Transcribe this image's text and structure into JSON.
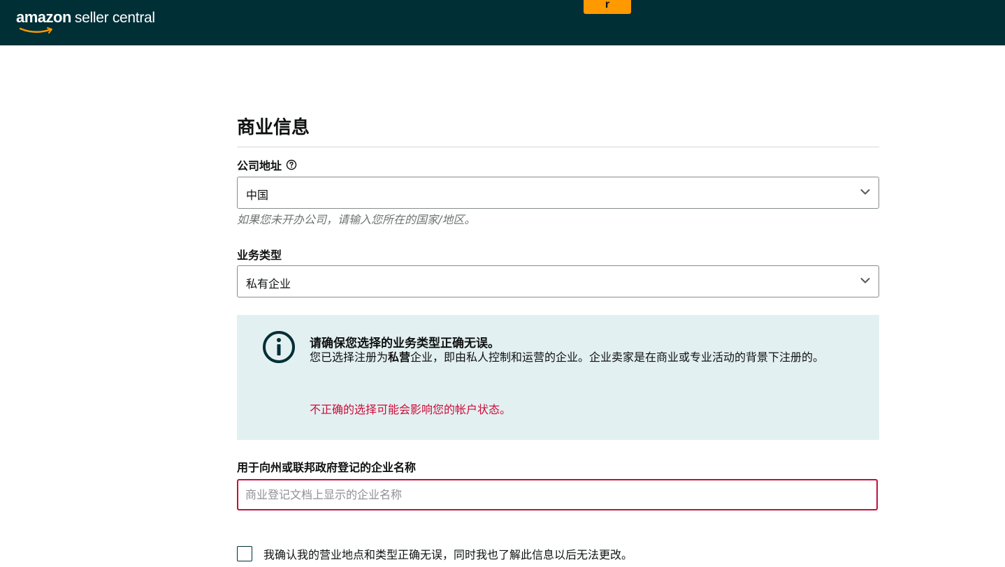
{
  "header": {
    "logo_amazon": "amazon",
    "logo_rest": "seller central",
    "tab_badge": "r",
    "background_color": "#002f36",
    "accent_color": "#ff9900"
  },
  "form": {
    "section_title": "商业信息",
    "company_address": {
      "label": "公司地址",
      "help_icon": "question-circle-icon",
      "selected_value": "中国",
      "hint": "如果您未开办公司，请输入您所在的国家/地区。"
    },
    "business_type": {
      "label": "业务类型",
      "selected_value": "私有企业"
    },
    "alert": {
      "icon": "info-circle-icon",
      "title": "请确保您选择的业务类型正确无误。",
      "body_prefix": "您已选择注册为",
      "body_bold": "私营",
      "body_suffix": "企业，即由私人控制和运营的企业。企业卖家是在商业或专业活动的背景下注册的。",
      "warning": "不正确的选择可能会影响您的帐户状态。",
      "warning_color": "#cc0c39",
      "background_color": "#e3f0f1"
    },
    "business_name": {
      "label": "用于向州或联邦政府登记的企业名称",
      "value": "",
      "placeholder": "商业登记文档上显示的企业名称",
      "error_border_color": "#c40f3d"
    },
    "confirm_checkbox": {
      "checked": false,
      "label": "我确认我的营业地点和类型正确无误，同时我也了解此信息以后无法更改。"
    }
  }
}
